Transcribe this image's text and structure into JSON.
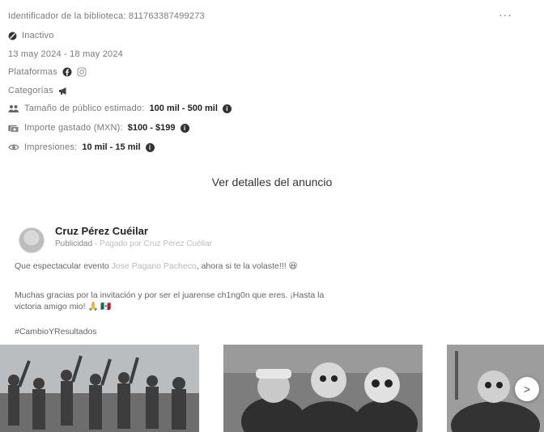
{
  "ad": {
    "library_id": "Identificador de la biblioteca: 811763387499273",
    "status": "Inactivo",
    "date_range": "13 may 2024 - 18 may 2024",
    "platforms_label": "Plataformas",
    "categories_label": "Categorías",
    "audience_label": "Tamaño de público estimado:",
    "audience_value": "100 mil - 500 mil",
    "spend_label": "Importe gastado (MXN):",
    "spend_value": "$100 - $199",
    "impressions_label": "Impresiones:",
    "impressions_value": "10 mil - 15 mil",
    "details_button": "Ver detalles del anuncio",
    "more_menu": "···"
  },
  "post": {
    "author": "Cruz Pérez Cuéilar",
    "sponsored": "Publicidad",
    "separator": " · ",
    "paid_by": "Pagado por Cruz Pérez Cuéllar",
    "line1_start": "Que espectacular evento ",
    "line1_mention": "Jose Pagano Pacheco",
    "line1_end": ", ahora si te la volaste!!! 😆",
    "line2": "Muchas gracias por la invitación y por ser el juarense ch1ng0n que eres. ¡Hasta la",
    "line3": "victoria amigo mio! 🙏 🇲🇽",
    "hashtag": "#CambioYResultados"
  },
  "carousel": {
    "next_label": ">"
  },
  "icons": {
    "status": "disabled-circle-icon",
    "facebook": "facebook-icon",
    "instagram": "instagram-icon",
    "megaphone": "megaphone-icon",
    "audience": "people-icon",
    "spend": "money-icon",
    "impressions": "eye-icon",
    "info": "info-icon"
  }
}
